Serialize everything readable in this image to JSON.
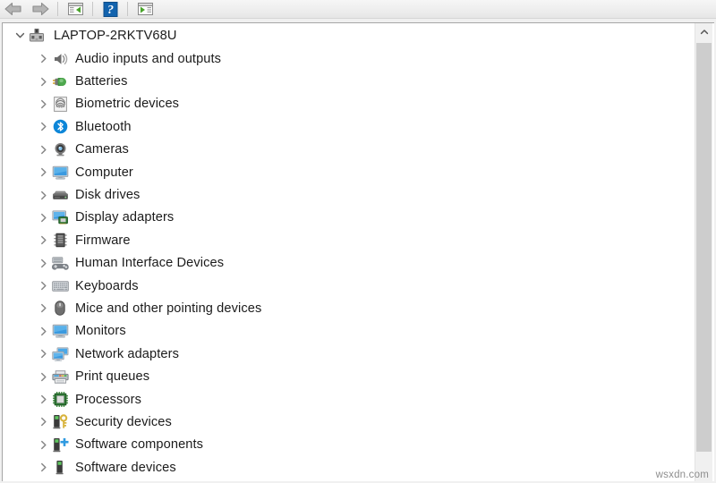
{
  "toolbar": {
    "buttons": [
      {
        "name": "back-button",
        "icon": "back-arrow-icon",
        "tooltip": "Back",
        "enabled": false
      },
      {
        "name": "forward-button",
        "icon": "forward-arrow-icon",
        "tooltip": "Forward",
        "enabled": false
      },
      {
        "name": "show-hide-console-tree-button",
        "icon": "console-tree-icon",
        "tooltip": "Show/Hide Console Tree",
        "enabled": true
      },
      {
        "name": "help-button",
        "icon": "help-question-icon",
        "tooltip": "Help",
        "enabled": true
      },
      {
        "name": "show-hide-action-pane-button",
        "icon": "action-pane-icon",
        "tooltip": "Show/Hide Action Pane",
        "enabled": true
      }
    ]
  },
  "tree": {
    "root": {
      "label": "LAPTOP-2RKTV68U",
      "icon": "computer-device-icon",
      "expanded": true,
      "chevron": "chevron-down-icon"
    },
    "items": [
      {
        "label": "Audio inputs and outputs",
        "icon": "speaker-icon",
        "chevron": "chevron-right-icon",
        "expanded": false
      },
      {
        "label": "Batteries",
        "icon": "battery-plug-icon",
        "chevron": "chevron-right-icon",
        "expanded": false
      },
      {
        "label": "Biometric devices",
        "icon": "fingerprint-icon",
        "chevron": "chevron-right-icon",
        "expanded": false
      },
      {
        "label": "Bluetooth",
        "icon": "bluetooth-icon",
        "chevron": "chevron-right-icon",
        "expanded": false
      },
      {
        "label": "Cameras",
        "icon": "camera-icon",
        "chevron": "chevron-right-icon",
        "expanded": false
      },
      {
        "label": "Computer",
        "icon": "monitor-icon",
        "chevron": "chevron-right-icon",
        "expanded": false
      },
      {
        "label": "Disk drives",
        "icon": "disk-drive-icon",
        "chevron": "chevron-right-icon",
        "expanded": false
      },
      {
        "label": "Display adapters",
        "icon": "display-adapter-icon",
        "chevron": "chevron-right-icon",
        "expanded": false
      },
      {
        "label": "Firmware",
        "icon": "firmware-chip-icon",
        "chevron": "chevron-right-icon",
        "expanded": false
      },
      {
        "label": "Human Interface Devices",
        "icon": "hid-gamepad-icon",
        "chevron": "chevron-right-icon",
        "expanded": false
      },
      {
        "label": "Keyboards",
        "icon": "keyboard-icon",
        "chevron": "chevron-right-icon",
        "expanded": false
      },
      {
        "label": "Mice and other pointing devices",
        "icon": "mouse-icon",
        "chevron": "chevron-right-icon",
        "expanded": false
      },
      {
        "label": "Monitors",
        "icon": "monitor-icon",
        "chevron": "chevron-right-icon",
        "expanded": false
      },
      {
        "label": "Network adapters",
        "icon": "network-adapter-icon",
        "chevron": "chevron-right-icon",
        "expanded": false
      },
      {
        "label": "Print queues",
        "icon": "printer-icon",
        "chevron": "chevron-right-icon",
        "expanded": false
      },
      {
        "label": "Processors",
        "icon": "processor-chip-icon",
        "chevron": "chevron-right-icon",
        "expanded": false
      },
      {
        "label": "Security devices",
        "icon": "security-key-icon",
        "chevron": "chevron-right-icon",
        "expanded": false
      },
      {
        "label": "Software components",
        "icon": "software-component-icon",
        "chevron": "chevron-right-icon",
        "expanded": false
      },
      {
        "label": "Software devices",
        "icon": "software-device-icon",
        "chevron": "chevron-right-icon",
        "expanded": false
      }
    ]
  },
  "scrollbar": {
    "up_arrow_icon": "chevron-up-icon",
    "orientation": "vertical"
  },
  "watermark": {
    "text": "wsxdn.com"
  },
  "colors": {
    "accent_blue": "#0a84d8",
    "bluetooth_blue": "#0d86d8",
    "green": "#2f8f2f",
    "text": "#1b1b1b",
    "chevron": "#7a7a7a",
    "scrollbar_thumb": "#cdcdcd",
    "background": "#f0f0f0"
  }
}
